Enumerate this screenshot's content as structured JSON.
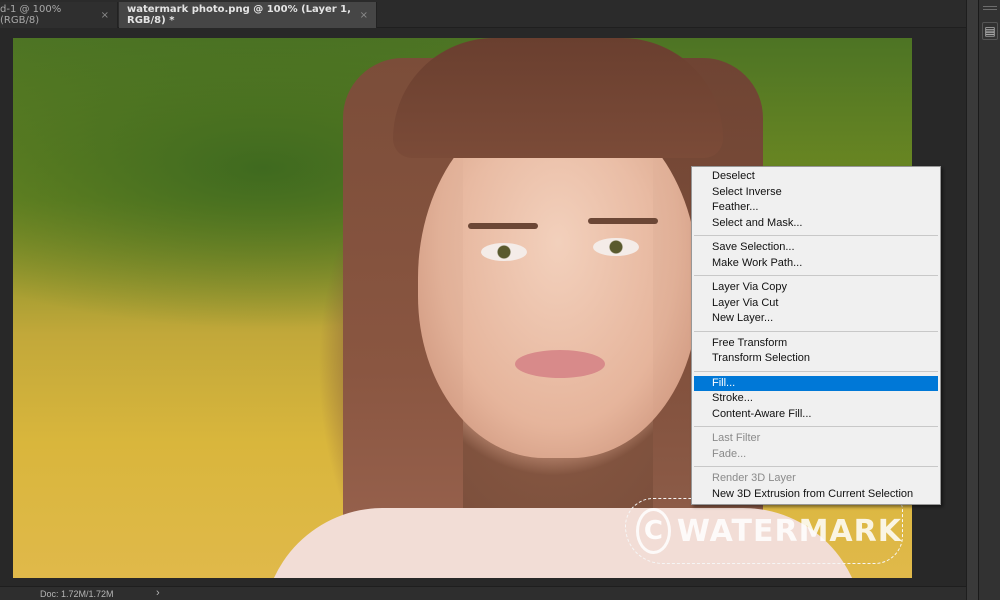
{
  "tabs": [
    {
      "label": "d-1 @ 100% (RGB/8)",
      "close": "×",
      "active": false
    },
    {
      "label": "watermark photo.png @ 100% (Layer 1, RGB/8) *",
      "close": "×",
      "active": true
    }
  ],
  "panel": {
    "icon": "properties-icon",
    "icon_glyph": "▤"
  },
  "watermark": {
    "symbol": "C",
    "text": "WATERMARK"
  },
  "context_menu": {
    "groups": [
      [
        {
          "label": "Deselect",
          "enabled": true
        },
        {
          "label": "Select Inverse",
          "enabled": true
        },
        {
          "label": "Feather...",
          "enabled": true
        },
        {
          "label": "Select and Mask...",
          "enabled": true
        }
      ],
      [
        {
          "label": "Save Selection...",
          "enabled": true
        },
        {
          "label": "Make Work Path...",
          "enabled": true
        }
      ],
      [
        {
          "label": "Layer Via Copy",
          "enabled": true
        },
        {
          "label": "Layer Via Cut",
          "enabled": true
        },
        {
          "label": "New Layer...",
          "enabled": true
        }
      ],
      [
        {
          "label": "Free Transform",
          "enabled": true
        },
        {
          "label": "Transform Selection",
          "enabled": true
        }
      ],
      [
        {
          "label": "Fill...",
          "enabled": true,
          "highlighted": true
        },
        {
          "label": "Stroke...",
          "enabled": true
        },
        {
          "label": "Content-Aware Fill...",
          "enabled": true
        }
      ],
      [
        {
          "label": "Last Filter",
          "enabled": false
        },
        {
          "label": "Fade...",
          "enabled": false
        }
      ],
      [
        {
          "label": "Render 3D Layer",
          "enabled": false
        },
        {
          "label": "New 3D Extrusion from Current Selection",
          "enabled": true
        }
      ]
    ]
  },
  "status": {
    "doc": "Doc: 1.72M/1.72M",
    "arrow": "›"
  },
  "colors": {
    "highlight": "#0078d7",
    "menu_bg": "#f0f0f0",
    "app_bg": "#282828"
  }
}
